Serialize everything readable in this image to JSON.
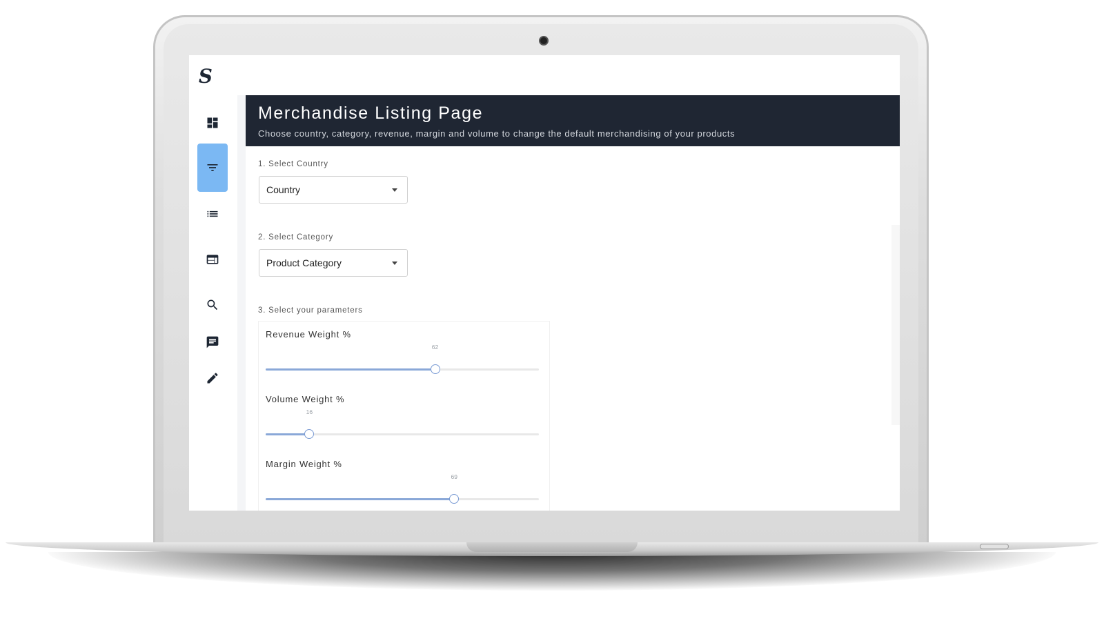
{
  "app": {
    "logo_text": "S"
  },
  "sidebar": {
    "items": [
      {
        "icon": "dashboard-icon",
        "active": false
      },
      {
        "icon": "filter-icon",
        "active": true
      },
      {
        "icon": "list-icon",
        "active": false
      },
      {
        "icon": "web-icon",
        "active": false
      },
      {
        "icon": "search-icon",
        "active": false
      },
      {
        "icon": "chat-icon",
        "active": false
      },
      {
        "icon": "edit-icon",
        "active": false
      }
    ],
    "active_color": "#7bb8f3"
  },
  "header": {
    "title": "Merchandise Listing Page",
    "subtitle": "Choose country, category, revenue, margin and volume to change the default merchandising of your products",
    "background": "#1f2633"
  },
  "step1": {
    "label": "1. Select Country",
    "select_value": "Country"
  },
  "step2": {
    "label": "2. Select Category",
    "select_value": "Product Category"
  },
  "step3": {
    "label": "3. Select your parameters",
    "sliders": [
      {
        "label": "Revenue Weight %",
        "value": 62,
        "value_text": "62"
      },
      {
        "label": "Volume Weight %",
        "value": 16,
        "value_text": "16"
      },
      {
        "label": "Margin Weight %",
        "value": 69,
        "value_text": "69"
      }
    ],
    "slider_color": "#8aa8d8"
  }
}
